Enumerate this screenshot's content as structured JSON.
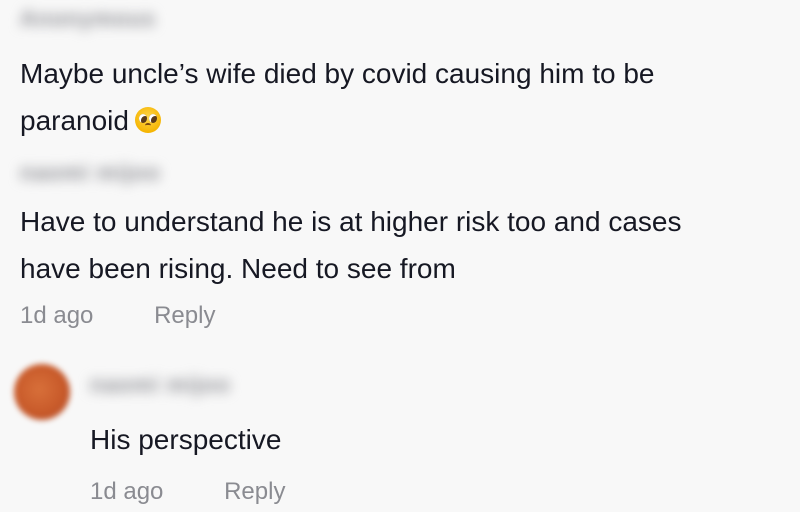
{
  "comments": [
    {
      "username": "Anonymous",
      "lines": [
        "Maybe uncle’s wife died by covid causing him to be",
        "paranoid"
      ],
      "emoji": "pleading-face-emoji"
    },
    {
      "username": "naomi mijoo",
      "lines": [
        "Have to understand he is at higher risk too and cases",
        "have been rising. Need to see from"
      ],
      "time": "1d ago",
      "reply_label": "Reply"
    }
  ],
  "reply": {
    "username": "naomi mijoo",
    "text": "His perspective",
    "time": "1d ago",
    "reply_label": "Reply"
  },
  "colors": {
    "background": "#f8f8f8",
    "text": "#161823",
    "meta": "#8a8b91",
    "avatar": "#c85a2a"
  }
}
